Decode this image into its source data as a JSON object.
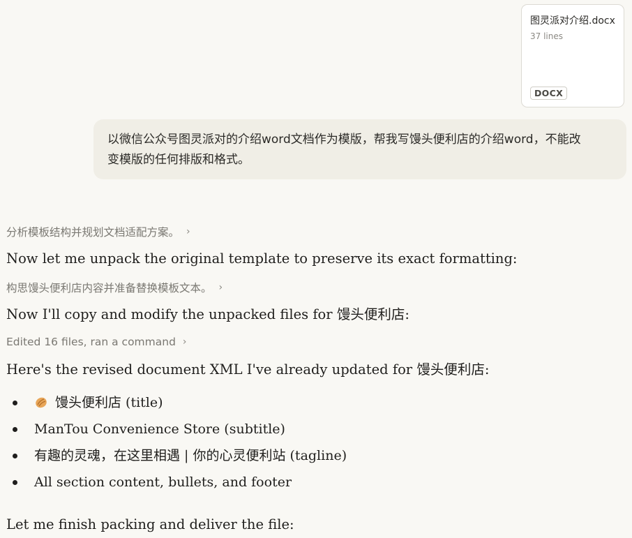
{
  "attachment": {
    "name": "图灵派对介绍.docx",
    "lines": "37 lines",
    "badge": "DOCX"
  },
  "user_message": {
    "text": "以微信公众号图灵派对的介绍word文档作为模版，帮我写馒头便利店的介绍word，不能改变模版的任何排版和格式。"
  },
  "assistant": {
    "thinking_1": "分析模板结构并规划文档适配方案。",
    "line_1": "Now let me unpack the original template to preserve its exact formatting:",
    "thinking_2": "构思馒头便利店内容并准备替换模板文本。",
    "line_2": "Now I'll copy and modify the unpacked files for 馒头便利店:",
    "tool_summary": "Edited 16 files, ran a command",
    "line_3": "Here's the revised document XML I've already updated for 馒头便利店:",
    "bullets": [
      {
        "text": "馒头便利店 (title)",
        "icon": "bread-icon"
      },
      {
        "text": "ManTou Convenience Store (subtitle)"
      },
      {
        "text": "有趣的灵魂，在这里相遇 | 你的心灵便利站 (tagline)"
      },
      {
        "text": "All section content, bullets, and footer"
      }
    ],
    "line_4": "Let me finish packing and deliver the file:"
  },
  "colors": {
    "background": "#f9f8f4",
    "bubble": "#f0eee6",
    "muted_text": "#7a7872",
    "body_text": "#1f1e1c"
  }
}
